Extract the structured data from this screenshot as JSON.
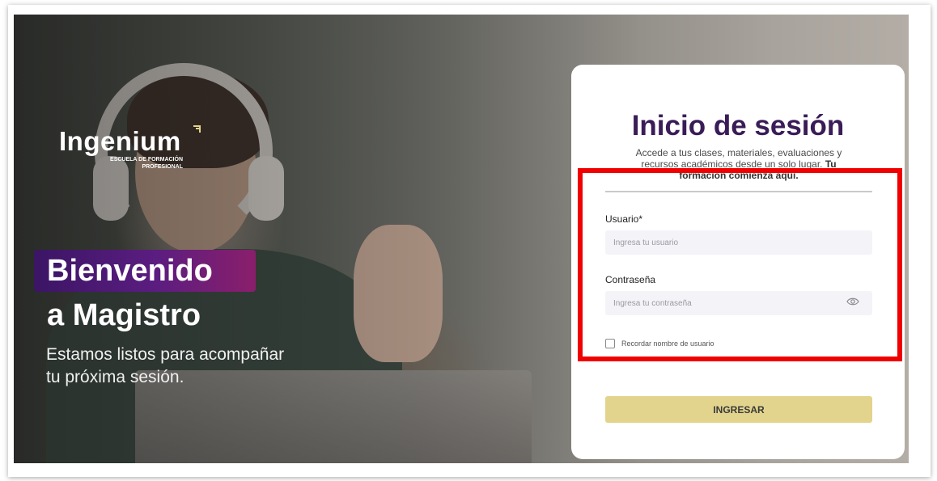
{
  "brand": {
    "logo_text": "Ingenium",
    "logo_subtitle_line1": "ESCUELA DE FORMACIÓN",
    "logo_subtitle_line2": "PROFESIONAL"
  },
  "hero": {
    "welcome_highlight": "Bienvenido",
    "welcome_line2": "a Magistro",
    "subtitle": "Estamos listos para acompañar tu próxima sesión."
  },
  "login": {
    "title": "Inicio de sesión",
    "description": "Accede a tus clases, materiales, evaluaciones y recursos académicos desde un solo lugar.",
    "description_bold": "Tu formación comienza aquí.",
    "username_label": "Usuario*",
    "username_placeholder": "Ingresa tu usuario",
    "password_label": "Contraseña",
    "password_placeholder": "Ingresa tu contraseña",
    "remember_label": "Recordar nombre de usuario",
    "submit_label": "INGRESAR"
  },
  "colors": {
    "title": "#3a1c57",
    "button": "#e2d48d",
    "badge_start": "#3b1565",
    "badge_end": "#8a1f6b",
    "highlight_box": "#f00000"
  },
  "icons": {
    "password_toggle": "eye-icon"
  }
}
